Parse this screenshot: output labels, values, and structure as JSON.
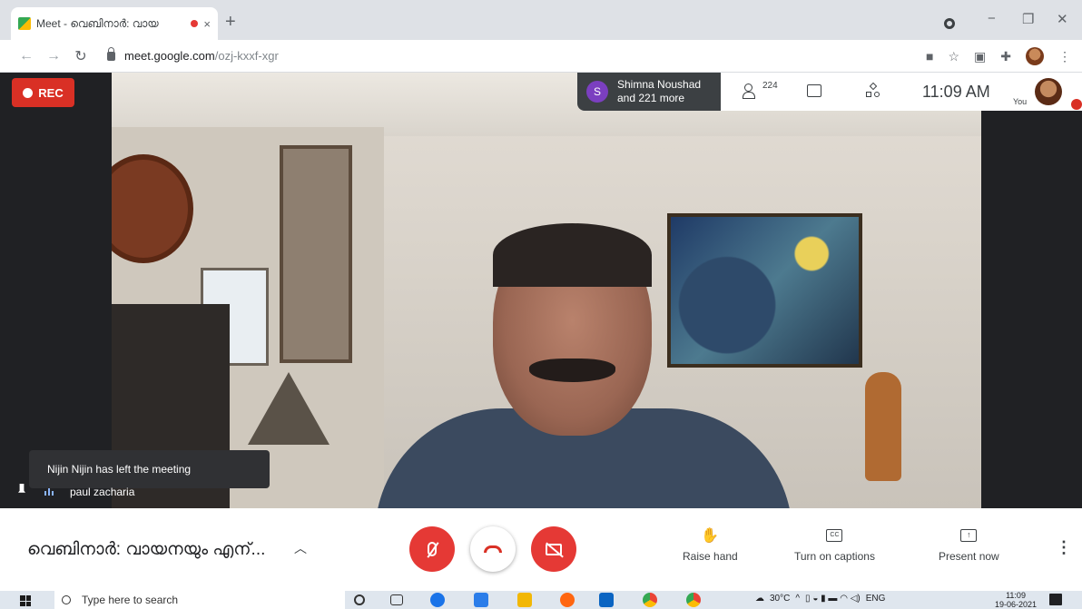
{
  "browser": {
    "tab_title": "Meet - വെബിനാർ: വായ",
    "tab_close": "×",
    "new_tab": "+",
    "url_host": "meet.google.com",
    "url_path": "/ozj-kxxf-xgr",
    "window_controls": [
      "−",
      "❐",
      "✕"
    ]
  },
  "meet": {
    "rec_label": "REC",
    "presenter_initial": "S",
    "presenter_name": "Shimna Noushad",
    "presenter_more": "and 221 more",
    "participant_count": "224",
    "time": "11:09 AM",
    "you_label": "You",
    "toast_message": "Nijin Nijin has left the meeting",
    "tile_name": "paul zacharia",
    "meeting_title": "വെബിനാർ: വായനയും എന്...",
    "raise_hand_label": "Raise hand",
    "captions_label": "Turn on captions",
    "present_label": "Present now",
    "cc_glyph": "CC"
  },
  "taskbar": {
    "search_placeholder": "Type here to search",
    "weather": "30°C",
    "language": "ENG",
    "clock_time": "11:09",
    "clock_date": "19-06-2021"
  },
  "colors": {
    "rec_red": "#d93025",
    "control_red": "#e53935",
    "presenter_avatar": "#7b3fc0"
  },
  "icons": [
    "chrome-meet-favicon",
    "back-arrow-icon",
    "forward-arrow-icon",
    "reload-icon",
    "lock-icon",
    "people-icon",
    "chat-icon",
    "activities-icon",
    "mic-off-icon",
    "hangup-icon",
    "camera-off-icon",
    "hand-icon",
    "captions-icon",
    "present-icon",
    "more-vert-icon",
    "windows-logo-icon",
    "search-icon"
  ]
}
